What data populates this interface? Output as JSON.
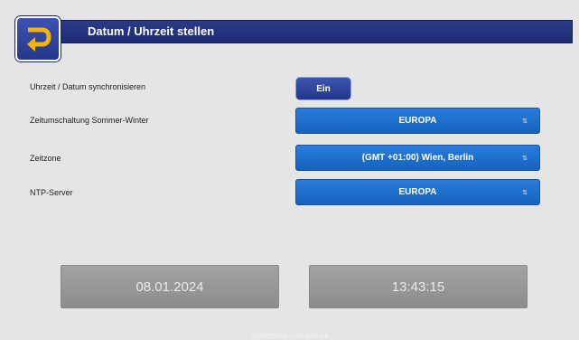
{
  "header": {
    "title": "Datum / Uhrzeit stellen"
  },
  "settings": [
    {
      "label": "Uhrzeit / Datum synchronisieren",
      "value": "Ein"
    },
    {
      "label": "Zeitumschaltung Sommer-Winter",
      "value": "EUROPA"
    },
    {
      "label": "Zeitzone",
      "value": "(GMT +01:00) Wien, Berlin"
    },
    {
      "label": "NTP-Server",
      "value": "EUROPA"
    }
  ],
  "date": "08.01.2024",
  "time": "13:43:15",
  "footer": "Speichern und zurück",
  "icons": {
    "back": "return-arrow-icon",
    "dropdown": "updown-arrows-icon"
  },
  "colors": {
    "header": "#1f2c73",
    "accent": "#f5b400",
    "select": "#1f6fcf",
    "background": "#e6e5e6"
  }
}
